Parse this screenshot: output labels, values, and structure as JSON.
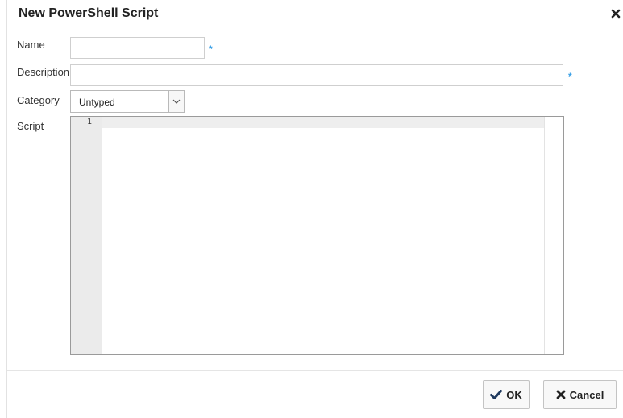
{
  "dialog": {
    "title": "New PowerShell Script",
    "close_icon": "close-icon"
  },
  "form": {
    "name_label": "Name",
    "name_value": "",
    "description_label": "Description",
    "description_value": "",
    "required_marker": "*",
    "category_label": "Category",
    "category_value": "Untyped",
    "script_label": "Script"
  },
  "editor": {
    "line_numbers": [
      "1"
    ],
    "content": ""
  },
  "buttons": {
    "ok_label": "OK",
    "ok_icon": "checkmark-icon",
    "cancel_label": "Cancel",
    "cancel_icon": "x-icon"
  },
  "colors": {
    "required": "#3aa0e6",
    "gutter": "#ebebeb"
  }
}
